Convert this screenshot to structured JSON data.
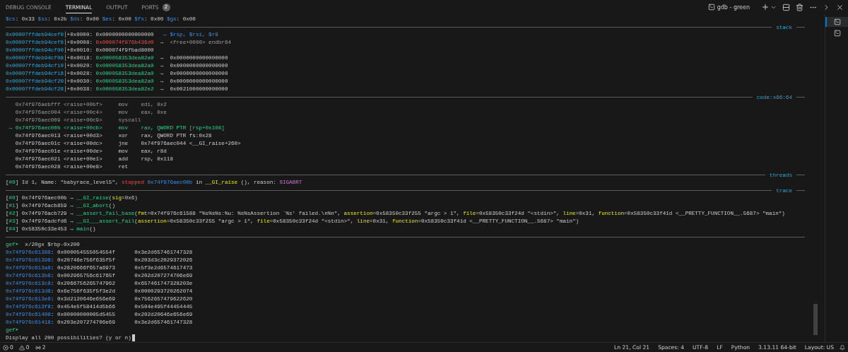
{
  "tabs": [
    {
      "label": "DEBUG CONSOLE",
      "selected": false
    },
    {
      "label": "TERMINAL",
      "selected": true
    },
    {
      "label": "OUTPUT",
      "selected": false
    },
    {
      "label": "PORTS",
      "selected": false,
      "badge": "2"
    }
  ],
  "terminal_title": "gdb - green",
  "sessions": [
    {
      "selected": true
    },
    {
      "selected": false
    }
  ],
  "lines": [
    {
      "kind": "text",
      "segments": [
        {
          "kind": "blue",
          "text": "$cs"
        },
        {
          "kind": "plain",
          "text": ": 0x33 "
        },
        {
          "kind": "blue",
          "text": "$ss"
        },
        {
          "kind": "plain",
          "text": ": 0x2b "
        },
        {
          "kind": "blue",
          "text": "$ds"
        },
        {
          "kind": "plain",
          "text": ": 0x00 "
        },
        {
          "kind": "blue",
          "text": "$es"
        },
        {
          "kind": "plain",
          "text": ": 0x00 "
        },
        {
          "kind": "blue",
          "text": "$fs"
        },
        {
          "kind": "plain",
          "text": ": 0x00 "
        },
        {
          "kind": "blue",
          "text": "$gs"
        },
        {
          "kind": "plain",
          "text": ": 0x00"
        }
      ]
    },
    {
      "kind": "rule",
      "label": "stack"
    },
    {
      "kind": "text",
      "segments": [
        {
          "kind": "cyan",
          "text": "0x00007ffdeb94cef0"
        },
        {
          "kind": "plain",
          "text": "│+0x0000: 0x0000000000000000   "
        },
        {
          "kind": "blue",
          "text": "← $rsp, $rsi, $r9"
        }
      ]
    },
    {
      "kind": "text",
      "segments": [
        {
          "kind": "cyan",
          "text": "0x00007ffdeb94cef8"
        },
        {
          "kind": "plain",
          "text": "│+0x0008: "
        },
        {
          "kind": "red",
          "text": "0x000074f976b436d0"
        },
        {
          "kind": "plain",
          "text": "  →  "
        },
        {
          "kind": "dim",
          "text": "<free+0000> endbr64"
        }
      ]
    },
    {
      "kind": "text",
      "segments": [
        {
          "kind": "cyan",
          "text": "0x00007ffdeb94cf00"
        },
        {
          "kind": "plain",
          "text": "│+0x0010: 0x000074f9fbad8000"
        }
      ]
    },
    {
      "kind": "text",
      "segments": [
        {
          "kind": "cyan",
          "text": "0x00007ffdeb94cf08"
        },
        {
          "kind": "plain",
          "text": "│+0x0018: "
        },
        {
          "kind": "green",
          "text": "0x000058353dea82a0"
        },
        {
          "kind": "plain",
          "text": "  →  0x0000000000000000"
        }
      ]
    },
    {
      "kind": "text",
      "segments": [
        {
          "kind": "cyan",
          "text": "0x00007ffdeb94cf10"
        },
        {
          "kind": "plain",
          "text": "│+0x0020: "
        },
        {
          "kind": "green",
          "text": "0x000058353dea82a0"
        },
        {
          "kind": "plain",
          "text": "  →  0x0000000000000000"
        }
      ]
    },
    {
      "kind": "text",
      "segments": [
        {
          "kind": "cyan",
          "text": "0x00007ffdeb94cf18"
        },
        {
          "kind": "plain",
          "text": "│+0x0028: "
        },
        {
          "kind": "green",
          "text": "0x000058353dea82a0"
        },
        {
          "kind": "plain",
          "text": "  →  0x0000000000000000"
        }
      ]
    },
    {
      "kind": "text",
      "segments": [
        {
          "kind": "cyan",
          "text": "0x00007ffdeb94cf20"
        },
        {
          "kind": "plain",
          "text": "│+0x0030: "
        },
        {
          "kind": "green",
          "text": "0x000058353dea82a0"
        },
        {
          "kind": "plain",
          "text": "  →  0x0000000000000000"
        }
      ]
    },
    {
      "kind": "text",
      "segments": [
        {
          "kind": "cyan",
          "text": "0x00007ffdeb94cf28"
        },
        {
          "kind": "plain",
          "text": "│+0x0038: "
        },
        {
          "kind": "green",
          "text": "0x000058353dea82e2"
        },
        {
          "kind": "plain",
          "text": "  →  0x0021000000000000"
        }
      ]
    },
    {
      "kind": "rule",
      "label": "code:x86:64"
    },
    {
      "kind": "text",
      "segments": [
        {
          "kind": "dim",
          "text": "   0x74f976aebfff <raise+00bf>     mov    edi, 0x2"
        }
      ]
    },
    {
      "kind": "text",
      "segments": [
        {
          "kind": "dim",
          "text": "   0x74f976aec004 <raise+00c4>     mov    eax, 0xe"
        }
      ]
    },
    {
      "kind": "text",
      "segments": [
        {
          "kind": "dim",
          "text": "   0x74f976aec009 <raise+00c9>     syscall"
        }
      ]
    },
    {
      "kind": "text",
      "segments": [
        {
          "kind": "green",
          "text": " → 0x74f976aec00b <raise+00cb>     mov    rax, QWORD PTR [rsp+0x108]"
        }
      ]
    },
    {
      "kind": "text",
      "segments": [
        {
          "kind": "plain",
          "text": "   0x74f976aec013 <raise+00d3>     xor    rax, QWORD PTR fs:0x28"
        }
      ]
    },
    {
      "kind": "text",
      "segments": [
        {
          "kind": "plain",
          "text": "   0x74f976aec01c <raise+00dc>     jne    0x74f976aec044 <__GI_raise+260>"
        }
      ]
    },
    {
      "kind": "text",
      "segments": [
        {
          "kind": "plain",
          "text": "   0x74f976aec01e <raise+00de>     mov    eax, r8d"
        }
      ]
    },
    {
      "kind": "text",
      "segments": [
        {
          "kind": "plain",
          "text": "   0x74f976aec021 <raise+00e1>     add    rsp, 0x118"
        }
      ]
    },
    {
      "kind": "text",
      "segments": [
        {
          "kind": "plain",
          "text": "   0x74f976aec028 <raise+00e8>     ret"
        }
      ]
    },
    {
      "kind": "rule",
      "label": "threads"
    },
    {
      "kind": "text",
      "segments": [
        {
          "kind": "plain",
          "text": "["
        },
        {
          "kind": "green",
          "text": "#0"
        },
        {
          "kind": "plain",
          "text": "] Id 1, Name: \"babyrace_level5\", "
        },
        {
          "kind": "red",
          "text": "stopped"
        },
        {
          "kind": "blue",
          "text": " 0x74f976aec00b"
        },
        {
          "kind": "plain",
          "text": " in "
        },
        {
          "kind": "yellow",
          "text": "__GI_raise"
        },
        {
          "kind": "plain",
          "text": " (), reason: "
        },
        {
          "kind": "magenta",
          "text": "SIGABRT"
        }
      ]
    },
    {
      "kind": "rule",
      "label": "trace"
    },
    {
      "kind": "text",
      "segments": [
        {
          "kind": "plain",
          "text": "["
        },
        {
          "kind": "green",
          "text": "#0"
        },
        {
          "kind": "plain",
          "text": "] 0x74f976aec00b → "
        },
        {
          "kind": "green",
          "text": "__GI_raise"
        },
        {
          "kind": "plain",
          "text": "("
        },
        {
          "kind": "yellow",
          "text": "sig"
        },
        {
          "kind": "plain",
          "text": "=0x6)"
        }
      ]
    },
    {
      "kind": "text",
      "segments": [
        {
          "kind": "plain",
          "text": "["
        },
        {
          "kind": "green",
          "text": "#1"
        },
        {
          "kind": "plain",
          "text": "] 0x74f976acb859 → "
        },
        {
          "kind": "green",
          "text": "__GI_abort"
        },
        {
          "kind": "plain",
          "text": "()"
        }
      ]
    },
    {
      "kind": "text",
      "segments": [
        {
          "kind": "plain",
          "text": "["
        },
        {
          "kind": "green",
          "text": "#2"
        },
        {
          "kind": "plain",
          "text": "] 0x74f976acb729 → "
        },
        {
          "kind": "green",
          "text": "__assert_fail_base"
        },
        {
          "kind": "plain",
          "text": "("
        },
        {
          "kind": "yellow",
          "text": "fmt"
        },
        {
          "kind": "plain",
          "text": "=0x74f976c61588 \"%s%s%s:%u: %s%sAssertion `%s' failed.\\n%n\", "
        },
        {
          "kind": "yellow",
          "text": "assertion"
        },
        {
          "kind": "plain",
          "text": "=0x58350c33f255 \"argc > 1\", "
        },
        {
          "kind": "yellow",
          "text": "file"
        },
        {
          "kind": "plain",
          "text": "=0x58350c33f24d \"<stdin>\", "
        },
        {
          "kind": "yellow",
          "text": "line"
        },
        {
          "kind": "plain",
          "text": "=0x31, "
        },
        {
          "kind": "yellow",
          "text": "function"
        },
        {
          "kind": "plain",
          "text": "=0x58350c33f41d <__PRETTY_FUNCTION__.5687> \"main\")"
        }
      ]
    },
    {
      "kind": "text",
      "segments": [
        {
          "kind": "plain",
          "text": "["
        },
        {
          "kind": "green",
          "text": "#3"
        },
        {
          "kind": "plain",
          "text": "] 0x74f976adcfd6 → "
        },
        {
          "kind": "green",
          "text": "__GI___assert_fail"
        },
        {
          "kind": "plain",
          "text": "("
        },
        {
          "kind": "yellow",
          "text": "assertion"
        },
        {
          "kind": "plain",
          "text": "=0x58350c33f255 \"argc > 1\", "
        },
        {
          "kind": "yellow",
          "text": "file"
        },
        {
          "kind": "plain",
          "text": "=0x58350c33f24d \"<stdin>\", "
        },
        {
          "kind": "yellow",
          "text": "line"
        },
        {
          "kind": "plain",
          "text": "=0x31, "
        },
        {
          "kind": "yellow",
          "text": "function"
        },
        {
          "kind": "plain",
          "text": "=0x58350c33f41d <__PRETTY_FUNCTION__.5687> \"main\")"
        }
      ]
    },
    {
      "kind": "text",
      "segments": [
        {
          "kind": "plain",
          "text": "["
        },
        {
          "kind": "green",
          "text": "#4"
        },
        {
          "kind": "plain",
          "text": "] 0x58350c33e453 → "
        },
        {
          "kind": "green",
          "text": "main"
        },
        {
          "kind": "plain",
          "text": "()"
        }
      ]
    },
    {
      "kind": "rule"
    },
    {
      "kind": "text",
      "segments": [
        {
          "kind": "green",
          "text": "gef➤ "
        },
        {
          "kind": "plain",
          "text": " x/20gx $rbp-0x200"
        }
      ]
    },
    {
      "kind": "text",
      "segments": [
        {
          "kind": "blue",
          "text": "0x74f976c61388"
        },
        {
          "kind": "plain",
          "text": ": 0x000054555054554f      0x3e2d657461747328"
        }
      ]
    },
    {
      "kind": "text",
      "segments": [
        {
          "kind": "blue",
          "text": "0x74f976c61398"
        },
        {
          "kind": "plain",
          "text": ": 0x20746e756f635f5f      0x203d3c2029372026"
        }
      ]
    },
    {
      "kind": "text",
      "segments": [
        {
          "kind": "blue",
          "text": "0x74f976c613a8"
        },
        {
          "kind": "plain",
          "text": ": 0x2820666f657a6973      0x5f3e2d6574617473"
        }
      ]
    },
    {
      "kind": "text",
      "segments": [
        {
          "kind": "blue",
          "text": "0x74f976c613b8"
        },
        {
          "kind": "plain",
          "text": ": 0x002965756c61765f      0x202d207274706e69"
        }
      ]
    },
    {
      "kind": "text",
      "segments": [
        {
          "kind": "blue",
          "text": "0x74f976c613c8"
        },
        {
          "kind": "plain",
          "text": ": 0x2066756265747962      0x657461747328203e"
        }
      ]
    },
    {
      "kind": "text",
      "segments": [
        {
          "kind": "blue",
          "text": "0x74f976c613d8"
        },
        {
          "kind": "plain",
          "text": ": 0x6e756f635f5f3e2d      0x0000293720262074"
        }
      ]
    },
    {
      "kind": "text",
      "segments": [
        {
          "kind": "blue",
          "text": "0x74f976c613e8"
        },
        {
          "kind": "plain",
          "text": ": 0x3d2120646e656e69      0x7562657479622620"
        }
      ]
    },
    {
      "kind": "text",
      "segments": [
        {
          "kind": "blue",
          "text": "0x74f976c613f8"
        },
        {
          "kind": "plain",
          "text": ": 0x454e5f58414d5b66      0x504e495f44454445"
        }
      ]
    },
    {
      "kind": "text",
      "segments": [
        {
          "kind": "blue",
          "text": "0x74f976c61408"
        },
        {
          "kind": "plain",
          "text": ": 0x00000000005d5455      0x202d20646e656e69"
        }
      ]
    },
    {
      "kind": "text",
      "segments": [
        {
          "kind": "blue",
          "text": "0x74f976c61418"
        },
        {
          "kind": "plain",
          "text": ": 0x203e207274706e69      0x3e2d657461747328"
        }
      ]
    },
    {
      "kind": "text",
      "segments": [
        {
          "kind": "green",
          "text": "gef➤ "
        }
      ]
    },
    {
      "kind": "prompt",
      "segments": [
        {
          "kind": "plain",
          "text": "Display all 200 possibilities? (y or n)"
        }
      ]
    }
  ],
  "status_bar": {
    "left": [
      {
        "kind": "errors",
        "text": "0"
      },
      {
        "kind": "warnings",
        "text": "0"
      },
      {
        "kind": "ports",
        "text": "2"
      }
    ],
    "right": [
      "Ln 21, Col 21",
      "Spaces: 4",
      "UTF-8",
      "LF",
      "Python",
      "3.13.11 64-bit",
      "Layout: US"
    ]
  }
}
